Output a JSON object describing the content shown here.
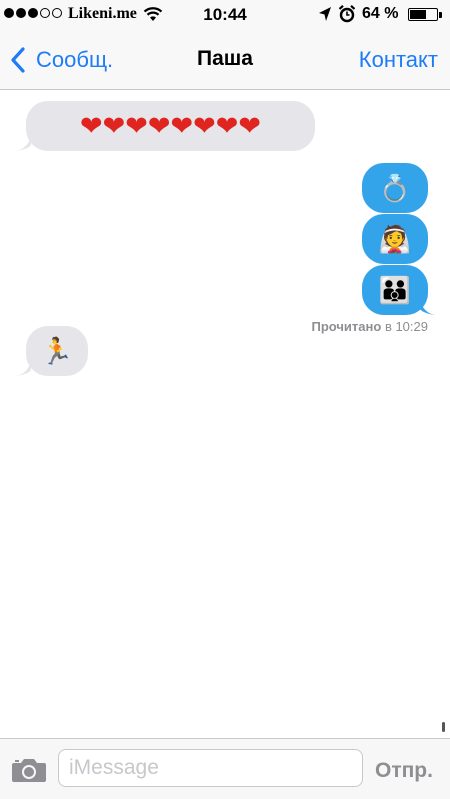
{
  "status_bar": {
    "carrier": "Likeni.me",
    "time": "10:44",
    "battery_percent": "64 %",
    "battery_level": 0.64,
    "signal_bars_filled": 3,
    "signal_bars_total": 5,
    "icons": [
      "wifi-icon",
      "location-arrow-icon",
      "alarm-clock-icon",
      "battery-icon"
    ]
  },
  "nav": {
    "back_label": "Сообщ.",
    "title": "Паша",
    "contact_label": "Контакт"
  },
  "messages": [
    {
      "direction": "incoming",
      "content": "❤❤❤❤❤❤❤❤",
      "emoji": [
        "heart",
        "heart",
        "heart",
        "heart",
        "heart",
        "heart",
        "heart",
        "heart"
      ]
    },
    {
      "direction": "outgoing",
      "content": "💍",
      "emoji": [
        "ring"
      ]
    },
    {
      "direction": "outgoing",
      "content": "👰",
      "emoji": [
        "bride-with-veil"
      ]
    },
    {
      "direction": "outgoing",
      "content": "👪",
      "emoji": [
        "family"
      ]
    },
    {
      "direction": "incoming",
      "content": "🏃",
      "emoji": [
        "runner"
      ]
    }
  ],
  "read_receipt": {
    "label": "Прочитано",
    "time": "в 10:29"
  },
  "input_bar": {
    "placeholder": "iMessage",
    "value": "",
    "send_label": "Отпр."
  },
  "colors": {
    "accent": "#1e7cf6",
    "outgoing_bubble": "#33a3ea",
    "incoming_bubble": "#e5e5ea",
    "heart": "#e0241f"
  }
}
